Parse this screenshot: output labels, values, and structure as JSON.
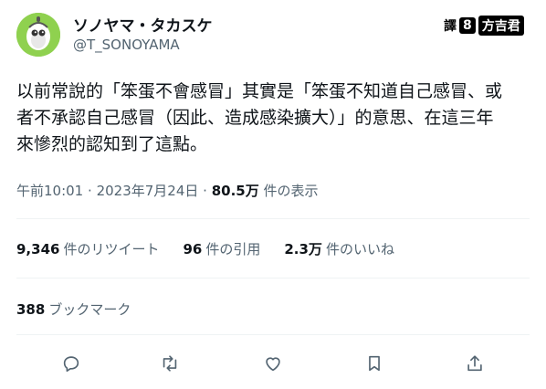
{
  "author": {
    "display_name": "ソノヤマ・タカスケ",
    "handle": "@T_SONOYAMA"
  },
  "translator_stamp": {
    "label": "譯",
    "badge": "8",
    "name": "方吉君"
  },
  "tweet": {
    "text": "以前常說的「笨蛋不會感冒」其實是「笨蛋不知道自己感冒、或\n者不承認自己感冒（因此、造成感染擴大）」的意思、在這三年\n來慘烈的認知到了這點。",
    "time": "午前10:01",
    "date": "2023年7月24日",
    "separator": "·",
    "views": "80.5万",
    "views_label": "件の表示"
  },
  "stats": {
    "retweets_count": "9,346",
    "retweets_label": "件のリツイート",
    "quotes_count": "96",
    "quotes_label": "件の引用",
    "likes_count": "2.3万",
    "likes_label": "件のいいね",
    "bookmarks_count": "388",
    "bookmarks_label": "ブックマーク"
  },
  "colors": {
    "text": "#0f1419",
    "secondary": "#536471",
    "divider": "#eff3f4",
    "avatar_bg": "#8fd14f"
  },
  "icons": [
    "reply-icon",
    "retweet-icon",
    "like-icon",
    "bookmark-icon",
    "share-icon"
  ]
}
